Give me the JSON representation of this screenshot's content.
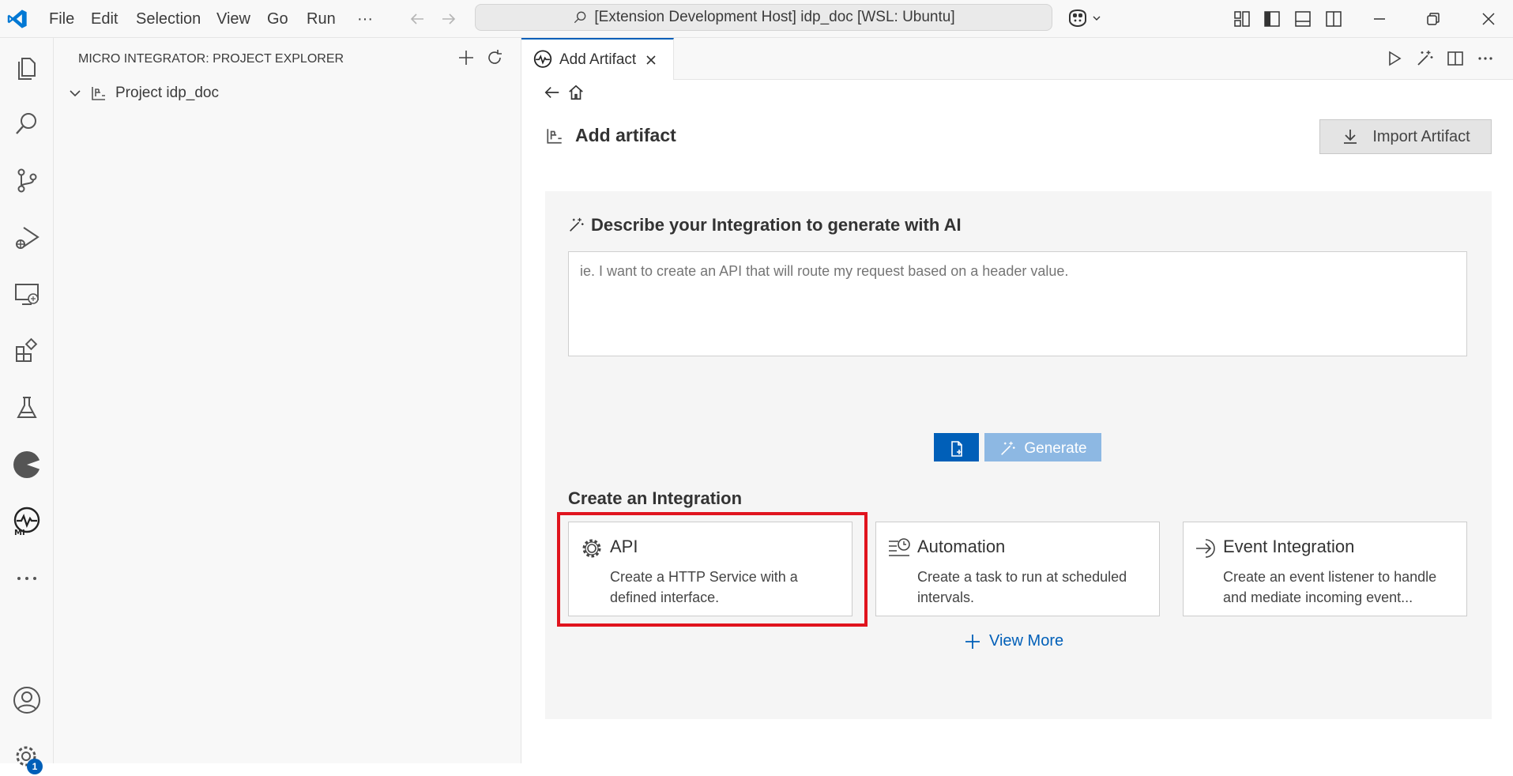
{
  "titlebar": {
    "menus": [
      "File",
      "Edit",
      "Selection",
      "View",
      "Go",
      "Run",
      "···"
    ],
    "search_text": "[Extension Development Host] idp_doc [WSL: Ubuntu]"
  },
  "activity_bar": {
    "icons": [
      "files-icon",
      "search-icon",
      "source-control-icon",
      "run-debug-icon",
      "remote-explorer-icon",
      "extensions-icon",
      "testing-icon",
      "wso2-icon",
      "micro-integrator-icon",
      "more-icon",
      "account-icon",
      "settings-icon"
    ],
    "settings_badge": "1"
  },
  "sidebar": {
    "title": "MICRO INTEGRATOR: PROJECT EXPLORER",
    "project_label": "Project idp_doc"
  },
  "editor": {
    "tab_label": "Add Artifact",
    "page_title": "Add artifact",
    "import_button": "Import Artifact",
    "ai_section": {
      "heading": "Describe your Integration to generate with AI",
      "placeholder": "ie. I want to create an API that will route my request based on a header value.",
      "generate_label": "Generate"
    },
    "create_section": {
      "heading": "Create an Integration",
      "cards": [
        {
          "title": "API",
          "desc": "Create a HTTP Service with a defined interface."
        },
        {
          "title": "Automation",
          "desc": "Create a task to run at scheduled intervals."
        },
        {
          "title": "Event Integration",
          "desc": "Create an event listener to handle and mediate incoming event..."
        }
      ],
      "view_more": "View More"
    }
  },
  "colors": {
    "accent": "#005fb8",
    "generate_disabled": "#8db8e3",
    "highlight": "#e0141e"
  }
}
